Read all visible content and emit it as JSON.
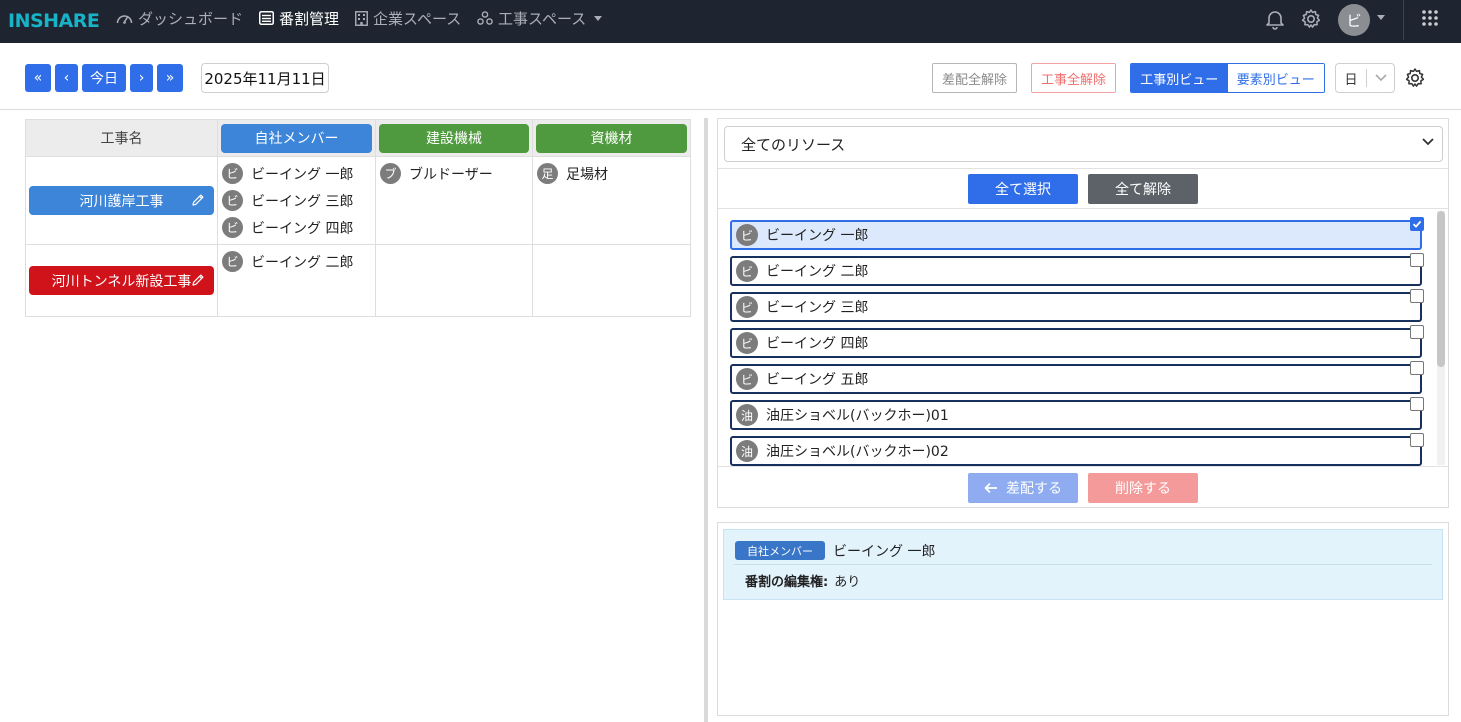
{
  "nav": {
    "logo_a": "INS",
    "logo_b": "HARE",
    "items": [
      {
        "label": "ダッシュボード"
      },
      {
        "label": "番割管理"
      },
      {
        "label": "企業スペース"
      },
      {
        "label": "工事スペース"
      }
    ],
    "avatar": "ビ"
  },
  "toolbar": {
    "first": "«",
    "prev": "‹",
    "today": "今日",
    "next": "›",
    "last": "»",
    "date": "2025年11月11日",
    "clear_all_assign": "差配全解除",
    "clear_all_project": "工事全解除",
    "view_by_project": "工事別ビュー",
    "view_by_element": "要素別ビュー",
    "unit": "日"
  },
  "table": {
    "col_name": "工事名",
    "col_member": "自社メンバー",
    "col_machine": "建設機械",
    "col_material": "資機材",
    "colors": {
      "member": "#3d85d8",
      "machine": "#4f9a3e",
      "material": "#4f9a3e"
    },
    "rows": [
      {
        "name": "河川護岸工事",
        "color": "#3d85d8",
        "members": [
          {
            "badge": "ビ",
            "name": "ビーイング 一郎"
          },
          {
            "badge": "ビ",
            "name": "ビーイング 三郎"
          },
          {
            "badge": "ビ",
            "name": "ビーイング 四郎"
          }
        ],
        "machines": [
          {
            "badge": "ブ",
            "name": "ブルドーザー"
          }
        ],
        "materials": [
          {
            "badge": "足",
            "name": "足場材"
          }
        ]
      },
      {
        "name": "河川トンネル新設工事",
        "color": "#d0121b",
        "members": [
          {
            "badge": "ビ",
            "name": "ビーイング 二郎"
          }
        ],
        "machines": [],
        "materials": []
      }
    ]
  },
  "panel": {
    "resource_filter": "全てのリソース",
    "select_all": "全て選択",
    "deselect_all": "全て解除",
    "assign": "差配する",
    "delete": "削除する",
    "items": [
      {
        "badge": "ビ",
        "name": "ビーイング 一郎"
      },
      {
        "badge": "ビ",
        "name": "ビーイング 二郎"
      },
      {
        "badge": "ビ",
        "name": "ビーイング 三郎"
      },
      {
        "badge": "ビ",
        "name": "ビーイング 四郎"
      },
      {
        "badge": "ビ",
        "name": "ビーイング 五郎"
      },
      {
        "badge": "油",
        "name": "油圧ショベル(バックホー)01"
      },
      {
        "badge": "油",
        "name": "油圧ショベル(バックホー)02"
      }
    ]
  },
  "detail": {
    "category": "自社メンバー",
    "name": "ビーイング 一郎",
    "perm_label": "番割の編集権:",
    "perm_value": "あり"
  }
}
